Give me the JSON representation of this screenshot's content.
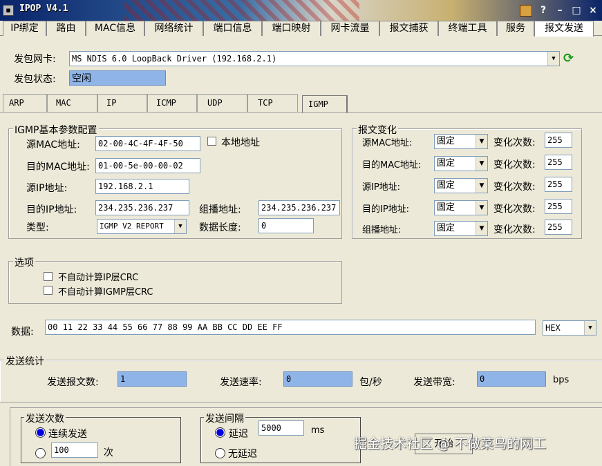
{
  "window": {
    "title": "IPOP V4.1",
    "controls": {
      "help": "?",
      "minimize": "–",
      "maximize": "□",
      "close": "×"
    }
  },
  "main_tabs": [
    "IP绑定",
    "路由",
    "MAC信息",
    "网络统计",
    "端口信息",
    "端口映射",
    "网卡流量",
    "报文捕获",
    "终端工具",
    "服务",
    "报文发送"
  ],
  "adapter": {
    "label": "发包网卡:",
    "value": "MS NDIS 6.0 LoopBack Driver (192.168.2.1)",
    "status_label": "发包状态:",
    "status_value": "空闲"
  },
  "protocol_tabs": [
    "ARP",
    "MAC",
    "IP",
    "ICMP",
    "UDP",
    "TCP",
    "IGMP"
  ],
  "igmp": {
    "group_title": "IGMP基本参数配置",
    "src_mac_label": "源MAC地址:",
    "src_mac": "02-00-4C-4F-4F-50",
    "local_addr_label": "本地地址",
    "dst_mac_label": "目的MAC地址:",
    "dst_mac": "01-00-5e-00-00-02",
    "src_ip_label": "源IP地址:",
    "src_ip": "192.168.2.1",
    "dst_ip_label": "目的IP地址:",
    "dst_ip": "234.235.236.237",
    "group_addr_label": "组播地址:",
    "group_addr": "234.235.236.237",
    "type_label": "类型:",
    "type_value": "IGMP V2 REPORT",
    "data_len_label": "数据长度:",
    "data_len": "0"
  },
  "variation": {
    "title": "报文变化",
    "rows": [
      {
        "label": "源MAC地址:",
        "mode": "固定",
        "count_label": "变化次数:",
        "count": "255"
      },
      {
        "label": "目的MAC地址:",
        "mode": "固定",
        "count_label": "变化次数:",
        "count": "255"
      },
      {
        "label": "源IP地址:",
        "mode": "固定",
        "count_label": "变化次数:",
        "count": "255"
      },
      {
        "label": "目的IP地址:",
        "mode": "固定",
        "count_label": "变化次数:",
        "count": "255"
      },
      {
        "label": "组播地址:",
        "mode": "固定",
        "count_label": "变化次数:",
        "count": "255"
      }
    ]
  },
  "options": {
    "title": "选项",
    "opt1": "不自动计算IP层CRC",
    "opt2": "不自动计算IGMP层CRC"
  },
  "data": {
    "label": "数据:",
    "value": "00 11 22 33 44 55 66 77 88 99 AA BB CC DD EE FF",
    "format": "HEX"
  },
  "stats": {
    "title": "发送统计",
    "sent_label": "发送报文数:",
    "sent": "1",
    "rate_label": "发送速率:",
    "rate": "0",
    "rate_unit": "包/秒",
    "bw_label": "发送带宽:",
    "bw": "0",
    "bw_unit": "bps"
  },
  "send_count": {
    "title": "发送次数",
    "continuous": "连续发送",
    "count": "100",
    "count_unit": "次"
  },
  "send_interval": {
    "title": "发送间隔",
    "delay": "延迟",
    "delay_value": "5000",
    "delay_unit": "ms",
    "no_delay": "无延迟"
  },
  "start_button": "开始",
  "watermark": "掘金技术社区 @ 不做菜鸟的网工"
}
